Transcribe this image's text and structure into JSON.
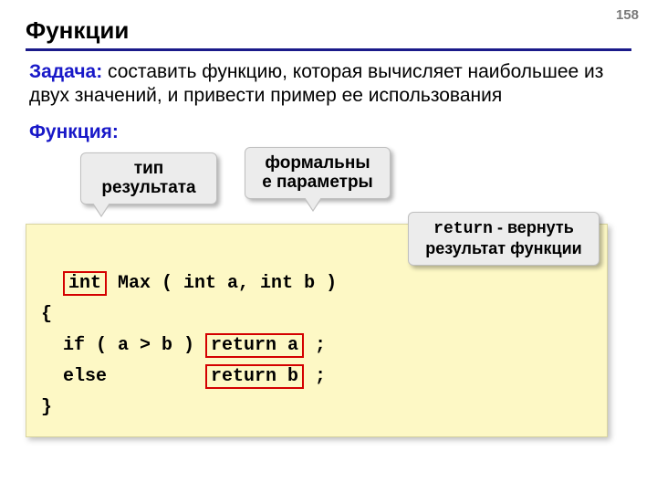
{
  "page_number": "158",
  "title": "Функции",
  "task_label": "Задача:",
  "task_text": " составить функцию, которая вычисляет наибольшее из двух значений, и привести пример ее использования",
  "func_label": "Функция:",
  "callout_result_type": "тип\nрезультата",
  "callout_formal_params": "формальны\nе параметры",
  "callout_return_kw": "return",
  "callout_return_text": " - вернуть результат функции",
  "code": {
    "int_kw": "int",
    "sig_rest": " Max ( int a, int b )",
    "brace_open": "{",
    "if_part": "  if ( a > b ) ",
    "ret_a": "return a",
    "semi_a": " ;",
    "else_part": "  else         ",
    "ret_b": "return b",
    "semi_b": " ;",
    "brace_close": "}"
  }
}
